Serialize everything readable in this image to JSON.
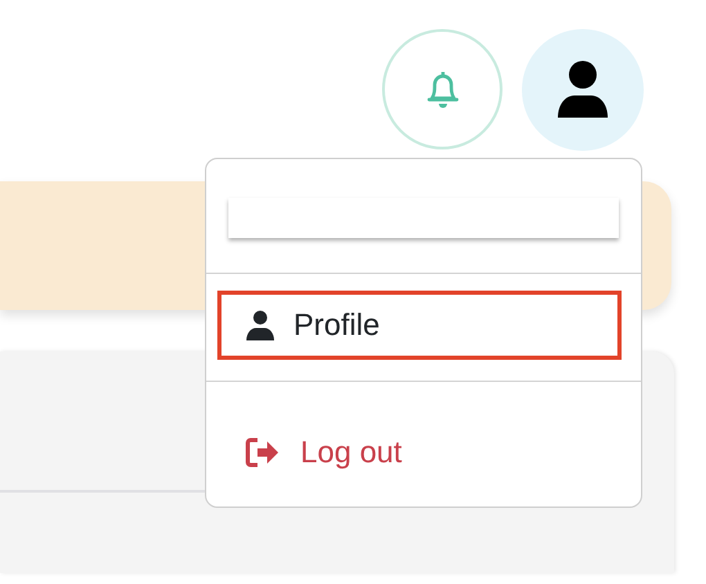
{
  "header": {
    "buttons": [
      {
        "kind": "bell"
      },
      {
        "kind": "user"
      }
    ]
  },
  "menu": {
    "items": [
      {
        "kind": "blank"
      },
      {
        "kind": "profile",
        "label": "Profile",
        "selected": true
      },
      {
        "kind": "logout",
        "label": "Log out",
        "selected": false
      }
    ]
  }
}
